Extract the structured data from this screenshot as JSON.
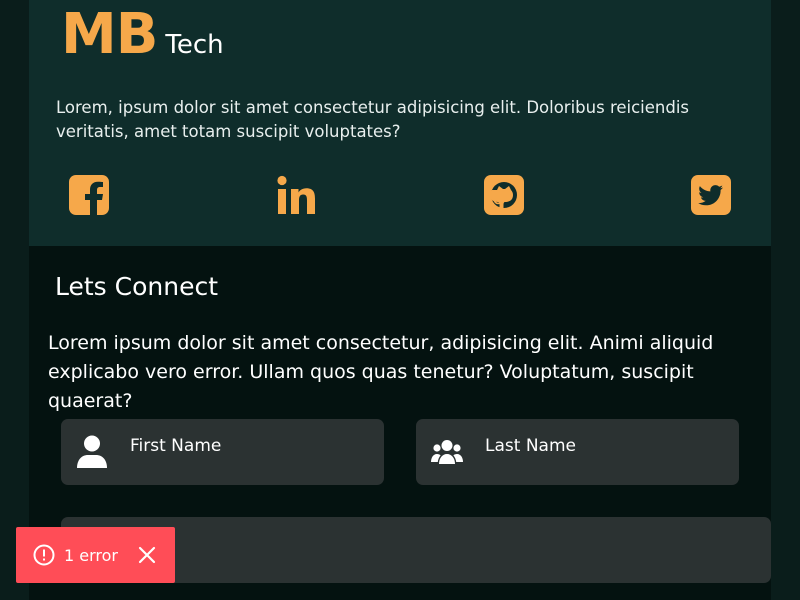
{
  "brand": {
    "logo_main": "MB",
    "logo_sub": "Tech",
    "description": "Lorem, ipsum dolor sit amet consectetur adipisicing elit. Doloribus reiciendis veritatis, amet totam suscipit voluptates?",
    "accent_color": "#f6a84a",
    "socials": [
      {
        "icon": "facebook-icon"
      },
      {
        "icon": "linkedin-icon"
      },
      {
        "icon": "github-icon"
      },
      {
        "icon": "twitter-icon"
      }
    ]
  },
  "connect": {
    "title": "Lets Connect",
    "description": "Lorem ipsum dolor sit amet consectetur, adipisicing elit. Animi aliquid explicabo vero error. Ullam quos quas tenetur? Voluptatum, suscipit quaerat?",
    "fields": {
      "first_name": {
        "placeholder": "First Name",
        "icon": "user-icon"
      },
      "last_name": {
        "placeholder": "Last Name",
        "icon": "users-icon"
      },
      "third": {
        "placeholder": ""
      }
    }
  },
  "error_toast": {
    "text": "1 error",
    "color": "#ff4d57",
    "icon": "alert-circle-icon",
    "close_icon": "close-icon"
  }
}
